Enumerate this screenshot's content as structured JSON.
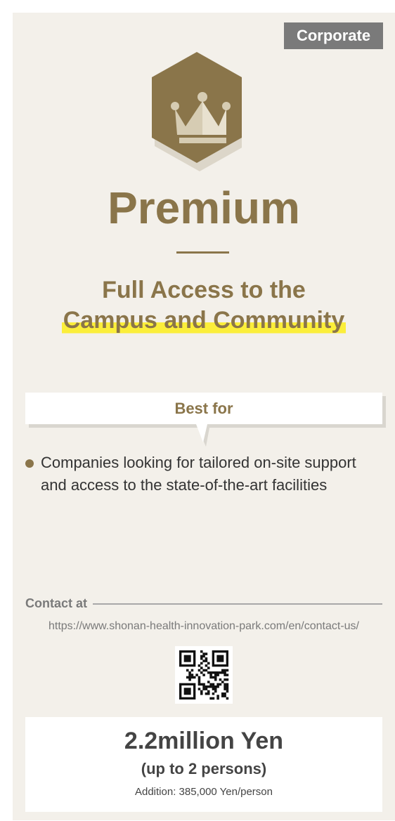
{
  "card": {
    "badge": "Corporate",
    "icon": "crown-icon",
    "title": "Premium",
    "subtitle_line1": "Full Access to the",
    "subtitle_line2": "Campus and Community",
    "best_for": {
      "label": "Best for",
      "items": [
        "Companies looking for tailored on-site support and access to the state-of-the-art facilities"
      ]
    },
    "contact": {
      "label": "Contact at",
      "url": "https://www.shonan-health-innovation-park.com/en/contact-us/",
      "qr_icon": "qr-code-icon"
    },
    "price": {
      "amount": "2.2million Yen",
      "persons": "(up to 2 persons)",
      "addition": "Addition: 385,000 Yen/person"
    }
  },
  "colors": {
    "background": "#f3f0ea",
    "accent_brown": "#8a754a",
    "badge_gray": "#7a7a7a",
    "highlight_yellow": "#fbee3a"
  }
}
